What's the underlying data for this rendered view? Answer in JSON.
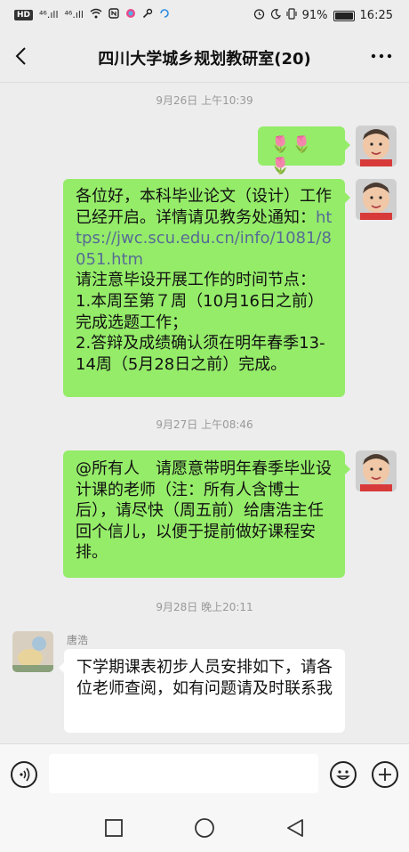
{
  "status": {
    "left_badge": "HD",
    "signal1": "⁴⁶.ıll",
    "signal2": "⁴⁶.ıll",
    "battery_pct": "91%",
    "time": "16:25"
  },
  "header": {
    "title": "四川大学城乡规划教研室(20)"
  },
  "timestamps": [
    "9月26日 上午10:39",
    "9月27日 上午08:46",
    "9月28日 晚上20:11"
  ],
  "messages": {
    "m1": "🌷🌷🌷",
    "m2_a": "各位好，本科毕业论文（设计）工作已经开启。详情请见教务处通知：",
    "m2_link": "https://jwc.scu.edu.cn/info/1081/8051.htm",
    "m2_b": "请注意毕设开展工作的时间节点：",
    "m2_c": "1.本周至第７周（10月16日之前）完成选题工作；",
    "m2_d": "2.答辩及成绩确认须在明年春季13-14周（5月28日之前）完成。",
    "m3": "@所有人　请愿意带明年春季毕业设计课的老师（注：所有人含博士后），请尽快（周五前）给唐浩主任回个信儿，以便于提前做好课程安排。",
    "m4_sender": "唐浩",
    "m4": "下学期课表初步人员安排如下，请各位老师查阅，如有问题请及时联系我"
  },
  "colors": {
    "bubble_self": "#95ec69",
    "bubble_other": "#ffffff",
    "link": "#576b95"
  }
}
